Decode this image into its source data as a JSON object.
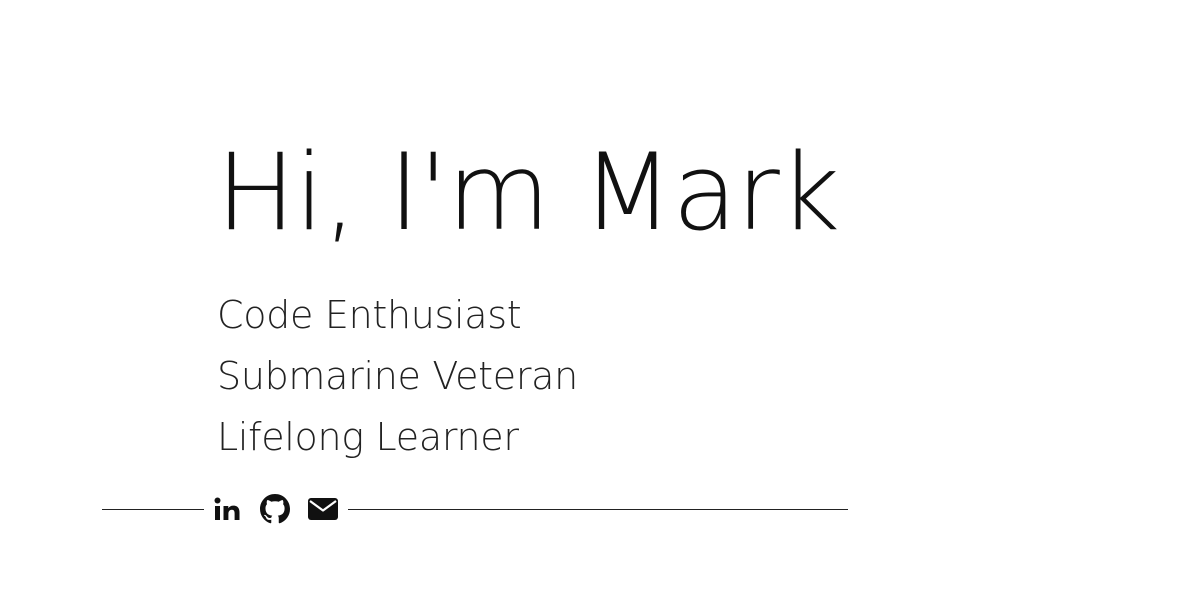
{
  "hero": {
    "title": "Hi, I'm Mark"
  },
  "taglines": [
    "Code Enthusiast",
    "Submarine Veteran",
    "Lifelong Learner"
  ],
  "social": {
    "links": [
      {
        "icon": "linkedin-icon"
      },
      {
        "icon": "github-icon"
      },
      {
        "icon": "envelope-icon"
      }
    ]
  },
  "colors": {
    "background": "#ffffff",
    "text": "#111111"
  }
}
